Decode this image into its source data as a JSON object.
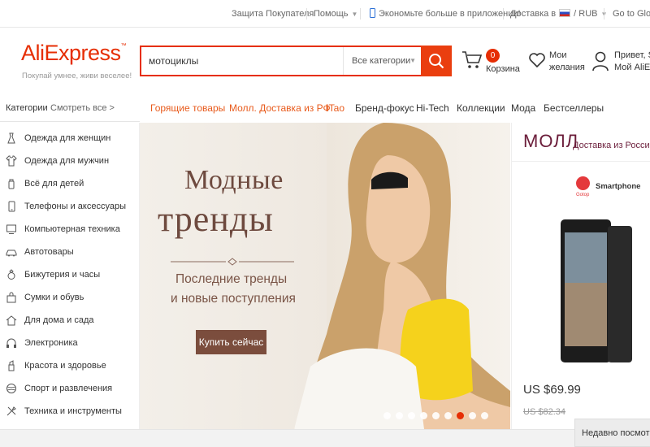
{
  "topbar": {
    "buyer_protection": "Защита Покупателя",
    "help": "Помощь",
    "app_promo": "Экономьте больше в приложении!",
    "delivery_to": "Доставка в",
    "currency": "RUB",
    "go_global": "Go to Global"
  },
  "header": {
    "logo_text": "AliExpress",
    "logo_tm": "™",
    "slogan": "Покупай умнее, живи веселее!",
    "search_value": "мотоциклы",
    "search_category": "Все категории",
    "cart_count": "0",
    "cart_label": "Корзина",
    "wishlist_line1": "Мои",
    "wishlist_line2": "желания",
    "account_line1": "Привет, Sign in",
    "account_line2": "Мой AliExpress"
  },
  "categories_bar": {
    "title": "Категории",
    "see_all": "Смотреть все >"
  },
  "nav": [
    {
      "label": "Горящие товары",
      "accent": true
    },
    {
      "label": "Молл. Доставка из РФ",
      "accent": true
    },
    {
      "label": "iTao",
      "accent": true
    },
    {
      "label": "Бренд-фокус",
      "accent": false
    },
    {
      "label": "Hi-Tech",
      "accent": false
    },
    {
      "label": "Коллекции",
      "accent": false
    },
    {
      "label": "Мода",
      "accent": false
    },
    {
      "label": "Бестселлеры",
      "accent": false
    }
  ],
  "sidebar": {
    "items": [
      {
        "label": "Одежда для женщин",
        "icon": "dress-icon"
      },
      {
        "label": "Одежда для мужчин",
        "icon": "shirt-icon"
      },
      {
        "label": "Всё для детей",
        "icon": "baby-bottle-icon"
      },
      {
        "label": "Телефоны и аксессуары",
        "icon": "phone-icon"
      },
      {
        "label": "Компьютерная техника",
        "icon": "computer-icon"
      },
      {
        "label": "Автотовары",
        "icon": "car-icon"
      },
      {
        "label": "Бижутерия и часы",
        "icon": "ring-icon"
      },
      {
        "label": "Сумки и обувь",
        "icon": "bag-icon"
      },
      {
        "label": "Для дома и сада",
        "icon": "house-icon"
      },
      {
        "label": "Электроника",
        "icon": "headphones-icon"
      },
      {
        "label": "Красота и здоровье",
        "icon": "beauty-icon"
      },
      {
        "label": "Спорт и развлечения",
        "icon": "ball-icon"
      },
      {
        "label": "Техника и инструменты",
        "icon": "tools-icon"
      }
    ]
  },
  "banner": {
    "title_line1": "Модные",
    "title_line2": "тренды",
    "subtitle_line1": "Последние тренды",
    "subtitle_line2": "и новые поступления",
    "cta": "Купить сейчас",
    "slides_count": 9,
    "active_slide": 7
  },
  "mall": {
    "title": "МОЛЛ",
    "subtitle": "Доставка из России",
    "brand_name": "Smartphone",
    "brand_sub": "Gotop",
    "price": "US $69.99",
    "old_price": "US $82.34"
  },
  "recently_viewed": "Недавно посмотренные",
  "colors": {
    "brand": "#e62e04",
    "nav_accent": "#e85a1b",
    "banner_text": "#6e4a3f",
    "cta_bg": "#7b4d3d",
    "mall_accent": "#6b1d3a"
  }
}
